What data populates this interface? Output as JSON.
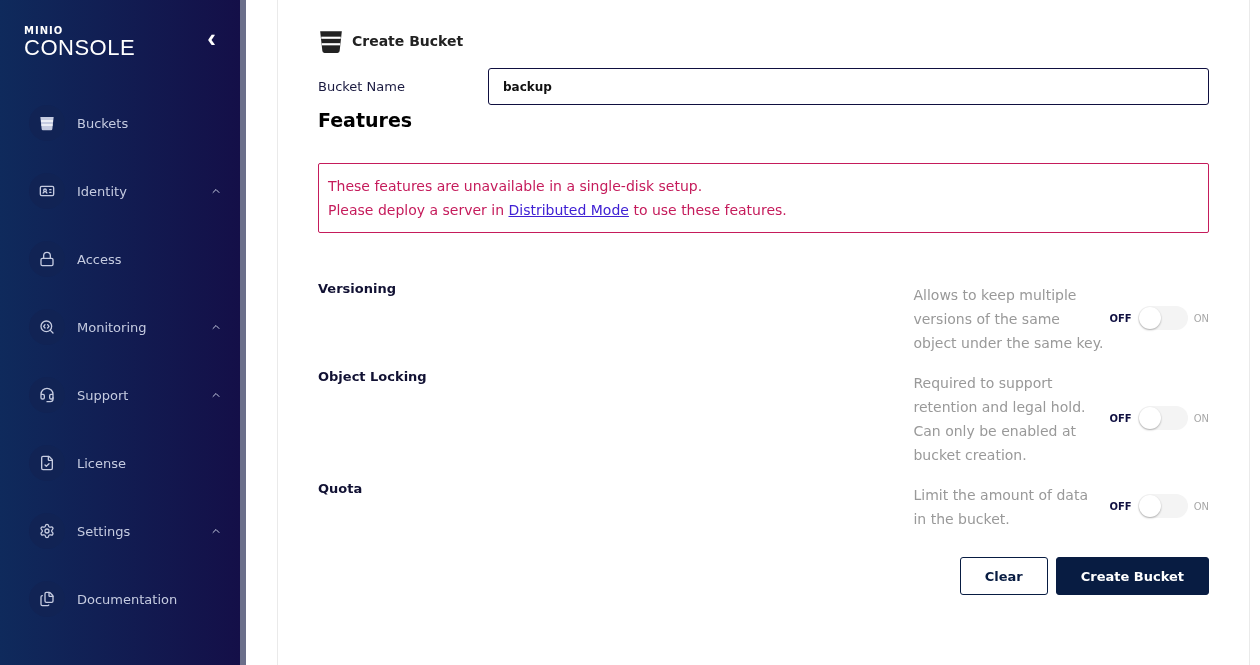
{
  "sidebar": {
    "logo_small": "MINIO",
    "logo_large": "CONSOLE",
    "collapse": "‹",
    "items": [
      {
        "label": "Buckets",
        "expandable": false
      },
      {
        "label": "Identity",
        "expandable": true
      },
      {
        "label": "Access",
        "expandable": false
      },
      {
        "label": "Monitoring",
        "expandable": true
      },
      {
        "label": "Support",
        "expandable": true
      },
      {
        "label": "License",
        "expandable": false
      },
      {
        "label": "Settings",
        "expandable": true
      },
      {
        "label": "Documentation",
        "expandable": false
      }
    ]
  },
  "form": {
    "title": "Create Bucket",
    "name_label": "Bucket Name",
    "name_value": "backup",
    "features_title": "Features",
    "warning": {
      "line1": "These features are unavailable in a single-disk setup.",
      "line2_before": "Please deploy a server in",
      "link": "Distributed Mode",
      "line2_after": "to use these features."
    },
    "features": [
      {
        "name": "Versioning",
        "description": "Allows to keep multiple versions of the same object under the same key.",
        "off_label": "OFF",
        "on_label": "ON",
        "on": false
      },
      {
        "name": "Object Locking",
        "description": "Required to support retention and legal hold. Can only be enabled at bucket creation.",
        "off_label": "OFF",
        "on_label": "ON",
        "on": false
      },
      {
        "name": "Quota",
        "description": "Limit the amount of data in the bucket.",
        "off_label": "OFF",
        "on_label": "ON",
        "on": false
      }
    ],
    "buttons": [
      {
        "label": "Clear",
        "kind": "secondary"
      },
      {
        "label": "Create Bucket",
        "kind": "primary"
      }
    ]
  }
}
